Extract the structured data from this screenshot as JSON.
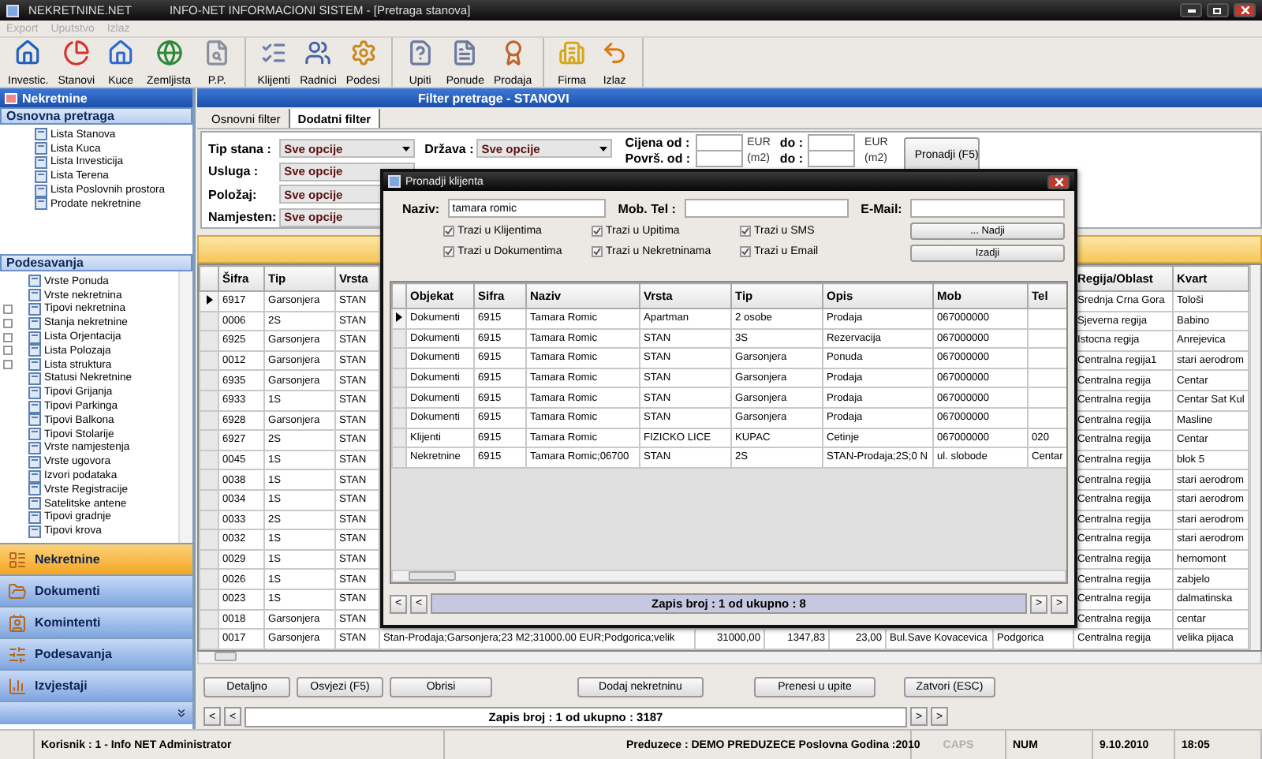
{
  "window": {
    "app_name": "NEKRETNINE.NET",
    "title": "INFO-NET INFORMACIONI SISTEM - [Pretraga stanova]"
  },
  "menu": [
    {
      "label": "Export",
      "disabled": true
    },
    {
      "label": "Uputstvo",
      "disabled": true
    },
    {
      "label": "Izlaz",
      "disabled": true
    }
  ],
  "toolbar_groups": [
    [
      "Investic.",
      "Stanovi",
      "Kuce",
      "Zemljista",
      "P.P."
    ],
    [
      "Klijenti",
      "Radnici",
      "Podesi"
    ],
    [
      "Upiti",
      "Ponude",
      "Prodaja"
    ],
    [
      "Firma",
      "Izlaz"
    ]
  ],
  "sidebar": {
    "title": "Nekretnine",
    "search_section": {
      "title": "Osnovna pretraga",
      "items": [
        "Lista Stanova",
        "Lista Kuca",
        "Lista Investicija",
        "Lista Terena",
        "Lista Poslovnih prostora",
        "Prodate nekretnine"
      ]
    },
    "settings_section": {
      "title": "Podesavanja",
      "items": [
        {
          "label": "Vrste Ponuda",
          "kind": "leaf"
        },
        {
          "label": "Vrste nekretnina",
          "kind": "leaf"
        },
        {
          "label": "Tipovi nekretnina",
          "kind": "group"
        },
        {
          "label": "Stanja nekretnine",
          "kind": "group"
        },
        {
          "label": "Lista Orjentacija",
          "kind": "group"
        },
        {
          "label": "Lista Polozaja",
          "kind": "group"
        },
        {
          "label": "Lista struktura",
          "kind": "group"
        },
        {
          "label": "Statusi Nekretnine",
          "kind": "leaf"
        },
        {
          "label": "Tipovi Grijanja",
          "kind": "leaf"
        },
        {
          "label": "Tipovi Parkinga",
          "kind": "leaf"
        },
        {
          "label": "Tipovi Balkona",
          "kind": "leaf"
        },
        {
          "label": "Tipovi Stolarije",
          "kind": "leaf"
        },
        {
          "label": "Vrste namjestenja",
          "kind": "leaf"
        },
        {
          "label": "Vrste ugovora",
          "kind": "leaf"
        },
        {
          "label": "Izvori podataka",
          "kind": "leaf"
        },
        {
          "label": "Vrste Registracije",
          "kind": "leaf"
        },
        {
          "label": "Satelitske antene",
          "kind": "leaf"
        },
        {
          "label": "Tipovi gradnje",
          "kind": "leaf"
        },
        {
          "label": "Tipovi krova",
          "kind": "leaf"
        }
      ]
    },
    "nav": [
      {
        "label": "Nekretnine",
        "selected": true
      },
      {
        "label": "Dokumenti",
        "selected": false
      },
      {
        "label": "Komintenti",
        "selected": false
      },
      {
        "label": "Podesavanja",
        "selected": false
      },
      {
        "label": "Izvjestaji",
        "selected": false
      }
    ]
  },
  "panel": {
    "title": "Filter pretrage - STANOVI",
    "tabs": [
      {
        "label": "Osnovni filter",
        "selected": false
      },
      {
        "label": "Dodatni filter",
        "selected": true
      }
    ],
    "filters_left": [
      {
        "label": "Tip stana :",
        "value": "Sve opcije"
      },
      {
        "label": "Usluga :",
        "value": "Sve opcije"
      },
      {
        "label": "Položaj:",
        "value": "Sve opcije"
      },
      {
        "label": "Namjesten:",
        "value": "Sve opcije"
      }
    ],
    "filters_mid": [
      {
        "label": "Država :",
        "value": "Sve opcije"
      }
    ],
    "ranges": [
      {
        "label": "Cijena od :",
        "unit": "EUR",
        "to_label": "do :",
        "to_unit": "EUR"
      },
      {
        "label": "Površ. od :",
        "unit": "(m2)",
        "to_label": "do :",
        "to_unit": "(m2)"
      }
    ],
    "search_button": "Pronadji (F5)"
  },
  "table": {
    "columns": {
      "sifra": "Šifra",
      "tip": "Tip",
      "vrsta": "Vrsta",
      "regija": "Regija/Oblast",
      "kvart": "Kvart"
    },
    "rows": [
      {
        "selected": true,
        "sifra": "6917",
        "tip": "Garsonjera",
        "vrsta": "STAN",
        "regija": "Srednja Crna Gora",
        "kvart": "Tološi"
      },
      {
        "selected": false,
        "sifra": "0006",
        "tip": "2S",
        "vrsta": "STAN",
        "regija": "Sjeverna regija",
        "kvart": "Babino"
      },
      {
        "selected": false,
        "sifra": "6925",
        "tip": "Garsonjera",
        "vrsta": "STAN",
        "regija": "Istocna regija",
        "kvart": "Anrejevica"
      },
      {
        "selected": false,
        "sifra": "0012",
        "tip": "Garsonjera",
        "vrsta": "STAN",
        "regija": "Centralna regija1",
        "kvart": "stari aerodrom"
      },
      {
        "selected": false,
        "sifra": "6935",
        "tip": "Garsonjera",
        "vrsta": "STAN",
        "regija": "Centralna regija",
        "kvart": "Centar"
      },
      {
        "selected": false,
        "sifra": "6933",
        "tip": "1S",
        "vrsta": "STAN",
        "regija": "Centralna regija",
        "kvart": "Centar Sat Kul"
      },
      {
        "selected": false,
        "sifra": "6928",
        "tip": "Garsonjera",
        "vrsta": "STAN",
        "regija": "Centralna regija",
        "kvart": "Masline"
      },
      {
        "selected": false,
        "sifra": "6927",
        "tip": "2S",
        "vrsta": "STAN",
        "regija": "Centralna regija",
        "kvart": "Centar"
      },
      {
        "selected": false,
        "sifra": "0045",
        "tip": "1S",
        "vrsta": "STAN",
        "regija": "Centralna regija",
        "kvart": "blok 5"
      },
      {
        "selected": false,
        "sifra": "0038",
        "tip": "1S",
        "vrsta": "STAN",
        "regija": "Centralna regija",
        "kvart": "stari aerodrom"
      },
      {
        "selected": false,
        "sifra": "0034",
        "tip": "1S",
        "vrsta": "STAN",
        "regija": "Centralna regija",
        "kvart": "stari aerodrom"
      },
      {
        "selected": false,
        "sifra": "0033",
        "tip": "2S",
        "vrsta": "STAN",
        "regija": "Centralna regija",
        "kvart": "stari aerodrom"
      },
      {
        "selected": false,
        "sifra": "0032",
        "tip": "1S",
        "vrsta": "STAN",
        "regija": "Centralna regija",
        "kvart": "stari aerodrom"
      },
      {
        "selected": false,
        "sifra": "0029",
        "tip": "1S",
        "vrsta": "STAN",
        "regija": "Centralna regija",
        "kvart": "hemomont"
      },
      {
        "selected": false,
        "sifra": "0026",
        "tip": "1S",
        "vrsta": "STAN",
        "regija": "Centralna regija",
        "kvart": "zabjelo"
      },
      {
        "selected": false,
        "sifra": "0023",
        "tip": "1S",
        "vrsta": "STAN",
        "regija": "Centralna regija",
        "kvart": "dalmatinska"
      },
      {
        "selected": false,
        "sifra": "0018",
        "tip": "Garsonjera",
        "vrsta": "STAN",
        "regija": "Centralna regija",
        "kvart": "centar"
      },
      {
        "selected": false,
        "sifra": "0017",
        "tip": "Garsonjera",
        "vrsta": "STAN",
        "details": [
          "Stan-Prodaja;Garsonjera;23 M2;31000.00 EUR;Podgorica;velik",
          "31000,00",
          "1347,83",
          "23,00",
          "Bul.Save Kovacevica",
          "Podgorica"
        ],
        "regija": "Centralna regija",
        "kvart": "velika pijaca"
      }
    ]
  },
  "buttons": [
    "Detaljno",
    "Osvjezi (F5)",
    "Obrisi",
    "Dodaj nekretninu",
    "Prenesi u upite",
    "Zatvori (ESC)"
  ],
  "pager": {
    "back": [
      "<",
      "<"
    ],
    "text": "Zapis broj : 1 od ukupno : 3187",
    "forward": [
      ">",
      ">"
    ]
  },
  "dialog": {
    "title": "Pronadji klijenta",
    "fields": [
      {
        "label": "Naziv:",
        "value": "tamara romic"
      },
      {
        "label": "Mob. Tel :"
      },
      {
        "label": "E-Mail:"
      }
    ],
    "checkboxes": [
      {
        "label": "Trazi u Klijentima",
        "checked": true
      },
      {
        "label": "Trazi u Upitima",
        "checked": true
      },
      {
        "label": "Trazi u SMS",
        "checked": true
      },
      {
        "label": "Trazi u Dokumentima",
        "checked": true
      },
      {
        "label": "Trazi u Nekretninama",
        "checked": true
      },
      {
        "label": "Trazi u Email",
        "checked": true
      }
    ],
    "buttons": [
      "... Nadji",
      "Izadji"
    ],
    "columns": [
      "Objekat",
      "Sifra",
      "Naziv",
      "Vrsta",
      "Tip",
      "Opis",
      "Mob",
      "Tel"
    ],
    "rows": [
      {
        "selected": true,
        "cells": [
          "Dokumenti",
          "6915",
          "Tamara Romic",
          "Apartman",
          "2 osobe",
          "Prodaja",
          "067000000"
        ]
      },
      {
        "selected": false,
        "cells": [
          "Dokumenti",
          "6915",
          "Tamara Romic",
          "STAN",
          "3S",
          "Rezervacija",
          "067000000"
        ]
      },
      {
        "selected": false,
        "cells": [
          "Dokumenti",
          "6915",
          "Tamara Romic",
          "STAN",
          "Garsonjera",
          "Ponuda",
          "067000000"
        ]
      },
      {
        "selected": false,
        "cells": [
          "Dokumenti",
          "6915",
          "Tamara Romic",
          "STAN",
          "Garsonjera",
          "Prodaja",
          "067000000"
        ]
      },
      {
        "selected": false,
        "cells": [
          "Dokumenti",
          "6915",
          "Tamara Romic",
          "STAN",
          "Garsonjera",
          "Prodaja",
          "067000000"
        ]
      },
      {
        "selected": false,
        "cells": [
          "Dokumenti",
          "6915",
          "Tamara Romic",
          "STAN",
          "Garsonjera",
          "Prodaja",
          "067000000"
        ]
      },
      {
        "selected": false,
        "cells": [
          "Klijenti",
          "6915",
          "Tamara Romic",
          "FIZICKO LICE",
          "KUPAC",
          "Cetinje",
          "067000000",
          "020"
        ]
      },
      {
        "selected": false,
        "cells": [
          "Nekretnine",
          "6915",
          "Tamara Romic;06700",
          "STAN",
          "2S",
          "STAN-Prodaja;2S;0 N",
          "ul. slobode",
          "Centar"
        ]
      }
    ],
    "pager": {
      "back": [
        "<",
        "<"
      ],
      "text": "Zapis broj : 1 od ukupno : 8",
      "forward": [
        ">",
        ">"
      ]
    }
  },
  "status_bar": {
    "user": "Korisnik : 1 - Info NET  Administrator",
    "company": "Preduzece : DEMO PREDUZECE   Poslovna Godina :2010",
    "caps": {
      "label": "CAPS",
      "on": false
    },
    "num": {
      "label": "NUM",
      "on": true
    },
    "date": "9.10.2010",
    "time": "18:05"
  }
}
